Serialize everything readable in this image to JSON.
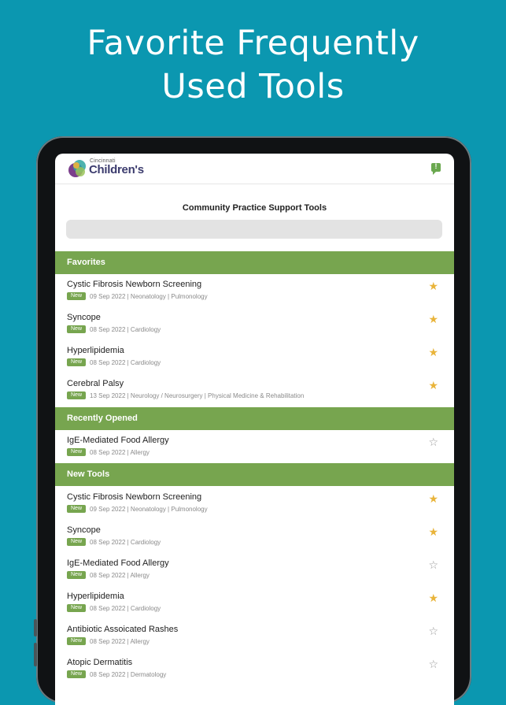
{
  "headline": {
    "line1": "Favorite Frequently",
    "line2": "Used Tools"
  },
  "app": {
    "logo_small": "Cincinnati",
    "logo_big": "Children's",
    "feedback_glyph": "!",
    "page_title": "Community Practice Support Tools",
    "search_placeholder": ""
  },
  "colors": {
    "background": "#0b97b0",
    "section": "#77a54f",
    "star_on": "#e9b43a"
  },
  "sections": [
    {
      "title": "Favorites",
      "items": [
        {
          "title": "Cystic Fibrosis Newborn Screening",
          "badge": "New",
          "meta": "09 Sep 2022  |  Neonatology  |  Pulmonology",
          "starred": true
        },
        {
          "title": "Syncope",
          "badge": "New",
          "meta": "08 Sep 2022  |  Cardiology",
          "starred": true
        },
        {
          "title": "Hyperlipidemia",
          "badge": "New",
          "meta": "08 Sep 2022  |  Cardiology",
          "starred": true
        },
        {
          "title": "Cerebral Palsy",
          "badge": "New",
          "meta": "13 Sep 2022  |  Neurology / Neurosurgery  |  Physical Medicine & Rehabilitation",
          "starred": true
        }
      ]
    },
    {
      "title": "Recently Opened",
      "items": [
        {
          "title": "IgE-Mediated Food Allergy",
          "badge": "New",
          "meta": "08 Sep 2022  |  Allergy",
          "starred": false
        }
      ]
    },
    {
      "title": "New Tools",
      "items": [
        {
          "title": "Cystic Fibrosis Newborn Screening",
          "badge": "New",
          "meta": "09 Sep 2022  |  Neonatology  |  Pulmonology",
          "starred": true
        },
        {
          "title": "Syncope",
          "badge": "New",
          "meta": "08 Sep 2022  |  Cardiology",
          "starred": true
        },
        {
          "title": "IgE-Mediated Food Allergy",
          "badge": "New",
          "meta": "08 Sep 2022  |  Allergy",
          "starred": false
        },
        {
          "title": "Hyperlipidemia",
          "badge": "New",
          "meta": "08 Sep 2022  |  Cardiology",
          "starred": true
        },
        {
          "title": "Antibiotic Assoicated Rashes",
          "badge": "New",
          "meta": "08 Sep 2022  |  Allergy",
          "starred": false
        },
        {
          "title": "Atopic Dermatitis",
          "badge": "New",
          "meta": "08 Sep 2022  |  Dermatology",
          "starred": false
        }
      ]
    }
  ],
  "icons": {
    "star_filled": "★",
    "star_empty": "☆",
    "feedback": "feedback-icon"
  }
}
